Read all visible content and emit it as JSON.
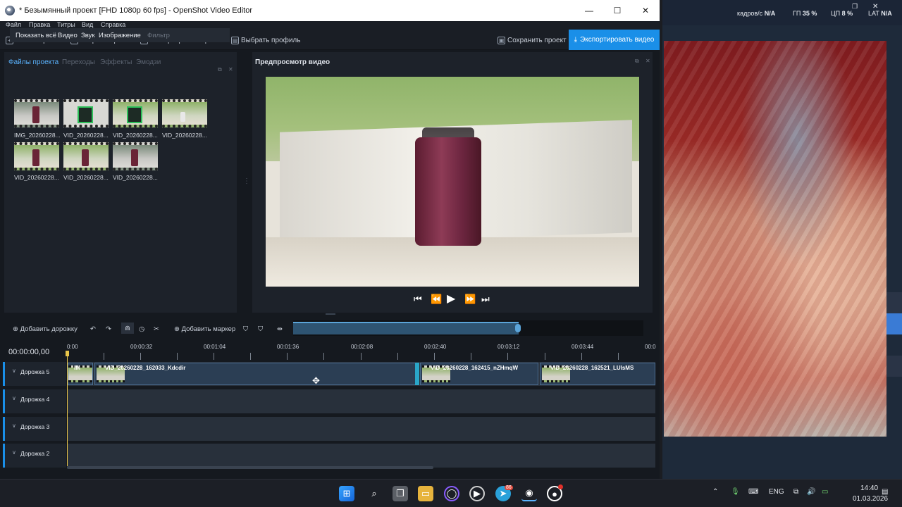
{
  "window": {
    "title": "* Безымянный проект [FHD 1080p 60 fps] - OpenShot Video Editor",
    "minimize": "—",
    "maximize": "☐",
    "close": "✕"
  },
  "menu": [
    "Файл",
    "Правка",
    "Титры",
    "Вид",
    "Справка"
  ],
  "toolbar": {
    "new_project": "Новый проект",
    "open_project": "Открыть проект",
    "import_files": "Импортировать файлы",
    "choose_profile": "Выбрать профиль",
    "save_project": "Сохранить проект",
    "export_video": "Экспортировать видео"
  },
  "files_panel": {
    "tabs": [
      "Файлы проекта",
      "Переходы",
      "Эффекты",
      "Эмодзи"
    ],
    "filters": [
      "Показать всё",
      "Видео",
      "Звук",
      "Изображение"
    ],
    "filter_placeholder": "Фильтр",
    "files": [
      "IMG_20260228...",
      "VID_20260228...",
      "VID_20260228...",
      "VID_20260228...",
      "VID_20260228...",
      "VID_20260228...",
      "VID_20260228..."
    ]
  },
  "preview": {
    "title": "Предпросмотр видео"
  },
  "timeline": {
    "add_track": "Добавить дорожку",
    "add_marker": "Добавить маркер",
    "timecode": "00:00:00,00",
    "ruler": [
      "0:00",
      "00:00:32",
      "00:01:04",
      "00:01:36",
      "00:02:08",
      "00:02:40",
      "00:03:12",
      "00:03:44",
      "00:0"
    ],
    "tracks": [
      "Дорожка 5",
      "Дорожка 4",
      "Дорожка 3",
      "Дорожка 2"
    ],
    "clips": [
      {
        "label": "IM"
      },
      {
        "label": "VID_20260228_162033_Kdcdir"
      },
      {
        "label": "VID_20260228_162415_nZHmqW"
      },
      {
        "label": "VID_20260228_162521_LUIsMS"
      }
    ]
  },
  "overlay_stats": {
    "fps_label": "кадров/с",
    "fps_value": "N/A",
    "gpu_label": "ГП",
    "gpu_value": "35 %",
    "cpu_label": "ЦП",
    "cpu_value": "8 %",
    "lat_label": "LAT",
    "lat_value": "N/A"
  },
  "taskbar": {
    "lang": "ENG",
    "time": "14:40",
    "date": "01.03.2026",
    "telegram_badge": "86"
  }
}
